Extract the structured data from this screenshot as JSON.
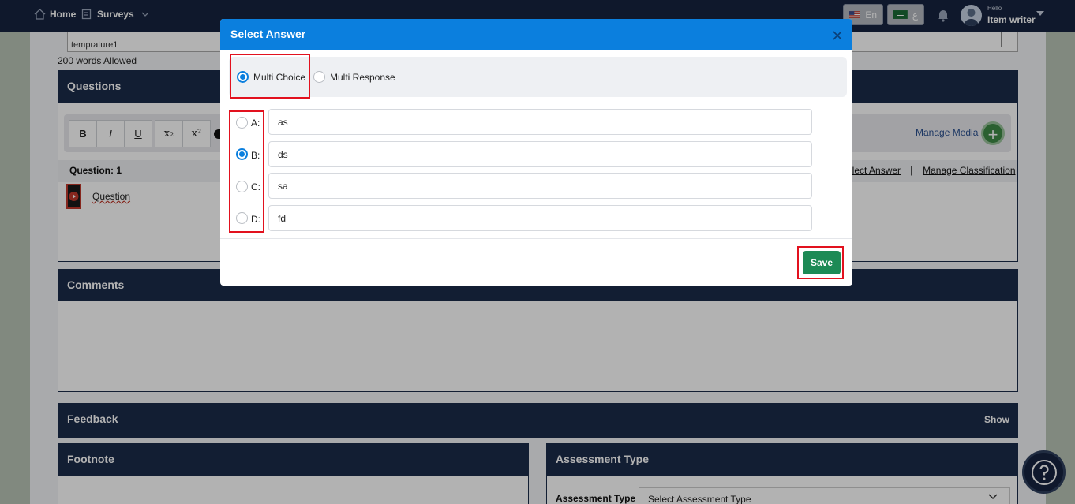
{
  "nav": {
    "home": "Home",
    "surveys": "Surveys",
    "lang_en": "En",
    "lang_ar": "ع",
    "hello": "Hello",
    "username": "Item writer"
  },
  "background": {
    "textarea_value": "temprature1",
    "words_allowed": "200 words Allowed",
    "questions_title": "Questions",
    "toolbar": [
      "B",
      "I",
      "U",
      "x₂",
      "x²"
    ],
    "manage_media": "Manage Media",
    "question_number": "Question: 1",
    "select_answer_link": "elect Answer",
    "link_separator": "|",
    "manage_classification_link": "Manage Classification",
    "question_text": "Question",
    "comments_title": "Comments",
    "feedback_title": "Feedback",
    "feedback_show": "Show",
    "footnote_title": "Footnote",
    "assessment_type_title": "Assessment Type",
    "assessment_type_label": "Assessment Type :",
    "assessment_type_placeholder": "Select Assessment Type"
  },
  "modal": {
    "title": "Select Answer",
    "types": [
      {
        "label": "Multi Choice",
        "selected": true
      },
      {
        "label": "Multi Response",
        "selected": false
      }
    ],
    "options": [
      {
        "letter": "A:",
        "value": "as",
        "selected": false
      },
      {
        "letter": "B:",
        "value": "ds",
        "selected": true
      },
      {
        "letter": "C:",
        "value": "sa",
        "selected": false
      },
      {
        "letter": "D:",
        "value": "fd",
        "selected": false
      }
    ],
    "save_label": "Save"
  },
  "colors": {
    "modal_header": "#0b7fde",
    "nav_bg": "#16233f",
    "save_button": "#1d8a55",
    "highlight": "#e2111e"
  }
}
